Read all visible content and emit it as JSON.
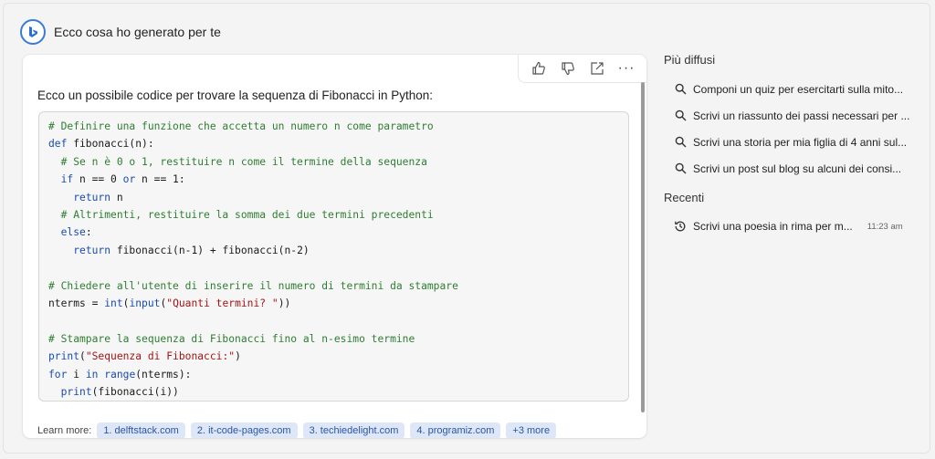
{
  "header": {
    "title": "Ecco cosa ho generato per te",
    "logo_icon": "bing-b-logo"
  },
  "toolbar": {
    "like_icon": "thumbs-up-icon",
    "dislike_icon": "thumbs-down-icon",
    "share_icon": "share-icon",
    "more_label": "···"
  },
  "message": {
    "intro": "Ecco un possibile codice per trovare la sequenza di Fibonacci in Python:",
    "code_lines": [
      "# Definire una funzione che accetta un numero n come parametro",
      "def fibonacci(n):",
      "  # Se n è 0 o 1, restituire n come il termine della sequenza",
      "  if n == 0 or n == 1:",
      "    return n",
      "  # Altrimenti, restituire la somma dei due termini precedenti",
      "  else:",
      "    return fibonacci(n-1) + fibonacci(n-2)",
      "",
      "# Chiedere all'utente di inserire il numero di termini da stampare",
      "nterms = int(input(\"Quanti termini? \"))",
      "",
      "# Stampare la sequenza di Fibonacci fino al n-esimo termine",
      "print(\"Sequenza di Fibonacci:\")",
      "for i in range(nterms):",
      "  print(fibonacci(i))"
    ],
    "learn_more_label": "Learn more:",
    "sources": [
      "1. delftstack.com",
      "2. it-code-pages.com",
      "3. techiedelight.com",
      "4. programiz.com",
      "+3 more"
    ]
  },
  "sidebar": {
    "popular_heading": "Più diffusi",
    "popular": [
      "Componi un quiz per esercitarti sulla mito...",
      "Scrivi un riassunto dei passi necessari per ...",
      "Scrivi una storia per mia figlia di 4 anni sul...",
      "Scrivi un post sul blog su alcuni dei consi..."
    ],
    "recent_heading": "Recenti",
    "recent": [
      {
        "text": "Scrivi una poesia in rima per m...",
        "time": "11:23 am"
      }
    ]
  }
}
